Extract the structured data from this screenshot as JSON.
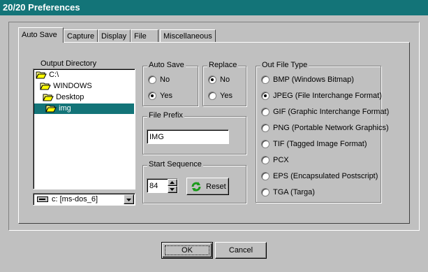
{
  "window": {
    "title": "20/20 Preferences"
  },
  "tabs": [
    "Auto Save",
    "Capture",
    "Display",
    "File",
    "Miscellaneous"
  ],
  "output_directory": {
    "label": "Output Directory",
    "tree": [
      "C:\\",
      "WINDOWS",
      "Desktop",
      "img"
    ],
    "selected": "img",
    "drive": "c: [ms-dos_6]"
  },
  "auto_save": {
    "label": "Auto Save",
    "options": [
      "No",
      "Yes"
    ],
    "selected": "Yes"
  },
  "replace": {
    "label": "Replace",
    "options": [
      "No",
      "Yes"
    ],
    "selected": "No"
  },
  "file_prefix": {
    "label": "File Prefix",
    "value": "IMG"
  },
  "start_sequence": {
    "label": "Start Sequence",
    "value": "84",
    "reset_label": "Reset"
  },
  "out_file_type": {
    "label": "Out File Type",
    "options": [
      "BMP (Windows Bitmap)",
      "JPEG (File Interchange Format)",
      "GIF (Graphic Interchange Format)",
      "PNG (Portable Network Graphics)",
      "TIF (Tagged Image Format)",
      "PCX",
      "EPS (Encapsulated Postscript)",
      "TGA (Targa)"
    ],
    "selected": "JPEG (File Interchange Format)"
  },
  "buttons": {
    "ok": "OK",
    "cancel": "Cancel"
  },
  "colors": {
    "titlebar": "#137478",
    "selection": "#137478",
    "face": "#c0c0c0"
  }
}
